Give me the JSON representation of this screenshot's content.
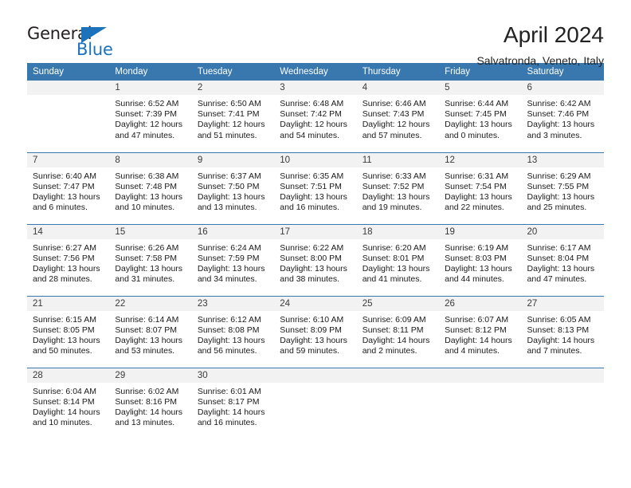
{
  "brand": {
    "name_part1": "General",
    "name_part2": "Blue",
    "triangle_icon": "triangle-icon",
    "accent_color": "#1c72bb"
  },
  "header": {
    "title": "April 2024",
    "subtitle": "Salvatronda, Veneto, Italy"
  },
  "calendar": {
    "header_bg": "#3878ae",
    "daynum_bg": "#f2f2f2",
    "weekday_headers": [
      "Sunday",
      "Monday",
      "Tuesday",
      "Wednesday",
      "Thursday",
      "Friday",
      "Saturday"
    ],
    "weeks": [
      [
        {
          "day": "",
          "sunrise": "",
          "sunset": "",
          "daylight_line1": "",
          "daylight_line2": ""
        },
        {
          "day": "1",
          "sunrise": "Sunrise: 6:52 AM",
          "sunset": "Sunset: 7:39 PM",
          "daylight_line1": "Daylight: 12 hours",
          "daylight_line2": "and 47 minutes."
        },
        {
          "day": "2",
          "sunrise": "Sunrise: 6:50 AM",
          "sunset": "Sunset: 7:41 PM",
          "daylight_line1": "Daylight: 12 hours",
          "daylight_line2": "and 51 minutes."
        },
        {
          "day": "3",
          "sunrise": "Sunrise: 6:48 AM",
          "sunset": "Sunset: 7:42 PM",
          "daylight_line1": "Daylight: 12 hours",
          "daylight_line2": "and 54 minutes."
        },
        {
          "day": "4",
          "sunrise": "Sunrise: 6:46 AM",
          "sunset": "Sunset: 7:43 PM",
          "daylight_line1": "Daylight: 12 hours",
          "daylight_line2": "and 57 minutes."
        },
        {
          "day": "5",
          "sunrise": "Sunrise: 6:44 AM",
          "sunset": "Sunset: 7:45 PM",
          "daylight_line1": "Daylight: 13 hours",
          "daylight_line2": "and 0 minutes."
        },
        {
          "day": "6",
          "sunrise": "Sunrise: 6:42 AM",
          "sunset": "Sunset: 7:46 PM",
          "daylight_line1": "Daylight: 13 hours",
          "daylight_line2": "and 3 minutes."
        }
      ],
      [
        {
          "day": "7",
          "sunrise": "Sunrise: 6:40 AM",
          "sunset": "Sunset: 7:47 PM",
          "daylight_line1": "Daylight: 13 hours",
          "daylight_line2": "and 6 minutes."
        },
        {
          "day": "8",
          "sunrise": "Sunrise: 6:38 AM",
          "sunset": "Sunset: 7:48 PM",
          "daylight_line1": "Daylight: 13 hours",
          "daylight_line2": "and 10 minutes."
        },
        {
          "day": "9",
          "sunrise": "Sunrise: 6:37 AM",
          "sunset": "Sunset: 7:50 PM",
          "daylight_line1": "Daylight: 13 hours",
          "daylight_line2": "and 13 minutes."
        },
        {
          "day": "10",
          "sunrise": "Sunrise: 6:35 AM",
          "sunset": "Sunset: 7:51 PM",
          "daylight_line1": "Daylight: 13 hours",
          "daylight_line2": "and 16 minutes."
        },
        {
          "day": "11",
          "sunrise": "Sunrise: 6:33 AM",
          "sunset": "Sunset: 7:52 PM",
          "daylight_line1": "Daylight: 13 hours",
          "daylight_line2": "and 19 minutes."
        },
        {
          "day": "12",
          "sunrise": "Sunrise: 6:31 AM",
          "sunset": "Sunset: 7:54 PM",
          "daylight_line1": "Daylight: 13 hours",
          "daylight_line2": "and 22 minutes."
        },
        {
          "day": "13",
          "sunrise": "Sunrise: 6:29 AM",
          "sunset": "Sunset: 7:55 PM",
          "daylight_line1": "Daylight: 13 hours",
          "daylight_line2": "and 25 minutes."
        }
      ],
      [
        {
          "day": "14",
          "sunrise": "Sunrise: 6:27 AM",
          "sunset": "Sunset: 7:56 PM",
          "daylight_line1": "Daylight: 13 hours",
          "daylight_line2": "and 28 minutes."
        },
        {
          "day": "15",
          "sunrise": "Sunrise: 6:26 AM",
          "sunset": "Sunset: 7:58 PM",
          "daylight_line1": "Daylight: 13 hours",
          "daylight_line2": "and 31 minutes."
        },
        {
          "day": "16",
          "sunrise": "Sunrise: 6:24 AM",
          "sunset": "Sunset: 7:59 PM",
          "daylight_line1": "Daylight: 13 hours",
          "daylight_line2": "and 34 minutes."
        },
        {
          "day": "17",
          "sunrise": "Sunrise: 6:22 AM",
          "sunset": "Sunset: 8:00 PM",
          "daylight_line1": "Daylight: 13 hours",
          "daylight_line2": "and 38 minutes."
        },
        {
          "day": "18",
          "sunrise": "Sunrise: 6:20 AM",
          "sunset": "Sunset: 8:01 PM",
          "daylight_line1": "Daylight: 13 hours",
          "daylight_line2": "and 41 minutes."
        },
        {
          "day": "19",
          "sunrise": "Sunrise: 6:19 AM",
          "sunset": "Sunset: 8:03 PM",
          "daylight_line1": "Daylight: 13 hours",
          "daylight_line2": "and 44 minutes."
        },
        {
          "day": "20",
          "sunrise": "Sunrise: 6:17 AM",
          "sunset": "Sunset: 8:04 PM",
          "daylight_line1": "Daylight: 13 hours",
          "daylight_line2": "and 47 minutes."
        }
      ],
      [
        {
          "day": "21",
          "sunrise": "Sunrise: 6:15 AM",
          "sunset": "Sunset: 8:05 PM",
          "daylight_line1": "Daylight: 13 hours",
          "daylight_line2": "and 50 minutes."
        },
        {
          "day": "22",
          "sunrise": "Sunrise: 6:14 AM",
          "sunset": "Sunset: 8:07 PM",
          "daylight_line1": "Daylight: 13 hours",
          "daylight_line2": "and 53 minutes."
        },
        {
          "day": "23",
          "sunrise": "Sunrise: 6:12 AM",
          "sunset": "Sunset: 8:08 PM",
          "daylight_line1": "Daylight: 13 hours",
          "daylight_line2": "and 56 minutes."
        },
        {
          "day": "24",
          "sunrise": "Sunrise: 6:10 AM",
          "sunset": "Sunset: 8:09 PM",
          "daylight_line1": "Daylight: 13 hours",
          "daylight_line2": "and 59 minutes."
        },
        {
          "day": "25",
          "sunrise": "Sunrise: 6:09 AM",
          "sunset": "Sunset: 8:11 PM",
          "daylight_line1": "Daylight: 14 hours",
          "daylight_line2": "and 2 minutes."
        },
        {
          "day": "26",
          "sunrise": "Sunrise: 6:07 AM",
          "sunset": "Sunset: 8:12 PM",
          "daylight_line1": "Daylight: 14 hours",
          "daylight_line2": "and 4 minutes."
        },
        {
          "day": "27",
          "sunrise": "Sunrise: 6:05 AM",
          "sunset": "Sunset: 8:13 PM",
          "daylight_line1": "Daylight: 14 hours",
          "daylight_line2": "and 7 minutes."
        }
      ],
      [
        {
          "day": "28",
          "sunrise": "Sunrise: 6:04 AM",
          "sunset": "Sunset: 8:14 PM",
          "daylight_line1": "Daylight: 14 hours",
          "daylight_line2": "and 10 minutes."
        },
        {
          "day": "29",
          "sunrise": "Sunrise: 6:02 AM",
          "sunset": "Sunset: 8:16 PM",
          "daylight_line1": "Daylight: 14 hours",
          "daylight_line2": "and 13 minutes."
        },
        {
          "day": "30",
          "sunrise": "Sunrise: 6:01 AM",
          "sunset": "Sunset: 8:17 PM",
          "daylight_line1": "Daylight: 14 hours",
          "daylight_line2": "and 16 minutes."
        },
        {
          "day": "",
          "sunrise": "",
          "sunset": "",
          "daylight_line1": "",
          "daylight_line2": ""
        },
        {
          "day": "",
          "sunrise": "",
          "sunset": "",
          "daylight_line1": "",
          "daylight_line2": ""
        },
        {
          "day": "",
          "sunrise": "",
          "sunset": "",
          "daylight_line1": "",
          "daylight_line2": ""
        },
        {
          "day": "",
          "sunrise": "",
          "sunset": "",
          "daylight_line1": "",
          "daylight_line2": ""
        }
      ]
    ]
  }
}
